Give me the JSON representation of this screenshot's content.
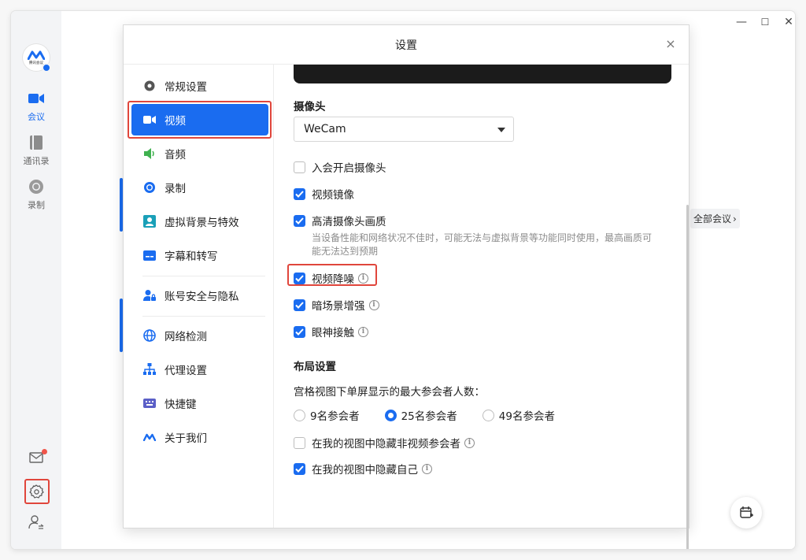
{
  "rail": {
    "logo_text": "腾讯会议",
    "items": [
      {
        "label": "会议",
        "icon": "video-camera-icon",
        "active": true
      },
      {
        "label": "通讯录",
        "icon": "contacts-book-icon",
        "active": false
      },
      {
        "label": "录制",
        "icon": "record-icon",
        "active": false
      }
    ]
  },
  "background": {
    "all_meetings": "全部会议",
    "window_controls": [
      "—",
      "☐",
      "✕"
    ]
  },
  "dialog": {
    "title": "设置",
    "close": "×",
    "nav": [
      {
        "label": "常规设置",
        "icon": "gear-icon"
      },
      {
        "label": "视频",
        "icon": "video-camera-icon",
        "active": true
      },
      {
        "label": "音频",
        "icon": "speaker-icon"
      },
      {
        "label": "录制",
        "icon": "record-icon"
      },
      {
        "label": "虚拟背景与特效",
        "icon": "portrait-icon"
      },
      {
        "label": "字幕和转写",
        "icon": "caption-icon"
      },
      {
        "label": "账号安全与隐私",
        "icon": "user-lock-icon"
      },
      {
        "label": "网络检测",
        "icon": "globe-icon"
      },
      {
        "label": "代理设置",
        "icon": "network-tree-icon"
      },
      {
        "label": "快捷键",
        "icon": "keyboard-icon"
      },
      {
        "label": "关于我们",
        "icon": "logo-icon"
      }
    ],
    "camera": {
      "section": "摄像头",
      "device": "WeCam",
      "options": [
        {
          "label": "入会开启摄像头",
          "checked": false,
          "info": false
        },
        {
          "label": "视频镜像",
          "checked": true,
          "info": false
        },
        {
          "label": "高清摄像头画质",
          "checked": true,
          "info": false
        },
        {
          "label": "视频降噪",
          "checked": true,
          "info": true
        },
        {
          "label": "暗场景增强",
          "checked": true,
          "info": true
        },
        {
          "label": "眼神接触",
          "checked": true,
          "info": true
        }
      ],
      "hd_hint": "当设备性能和网络状况不佳时，可能无法与虚拟背景等功能同时使用，最高画质可能无法达到预期"
    },
    "layout": {
      "section": "布局设置",
      "max_label": "宫格视图下单屏显示的最大参会者人数：",
      "radios": [
        {
          "label": "9名参会者",
          "selected": false
        },
        {
          "label": "25名参会者",
          "selected": true
        },
        {
          "label": "49名参会者",
          "selected": false
        }
      ],
      "hide_non_video": {
        "label": "在我的视图中隐藏非视频参会者",
        "checked": false
      },
      "hide_self": {
        "label": "在我的视图中隐藏自己",
        "checked": true
      }
    }
  },
  "colors": {
    "accent": "#1a6cf0",
    "highlight": "#e0463c"
  }
}
